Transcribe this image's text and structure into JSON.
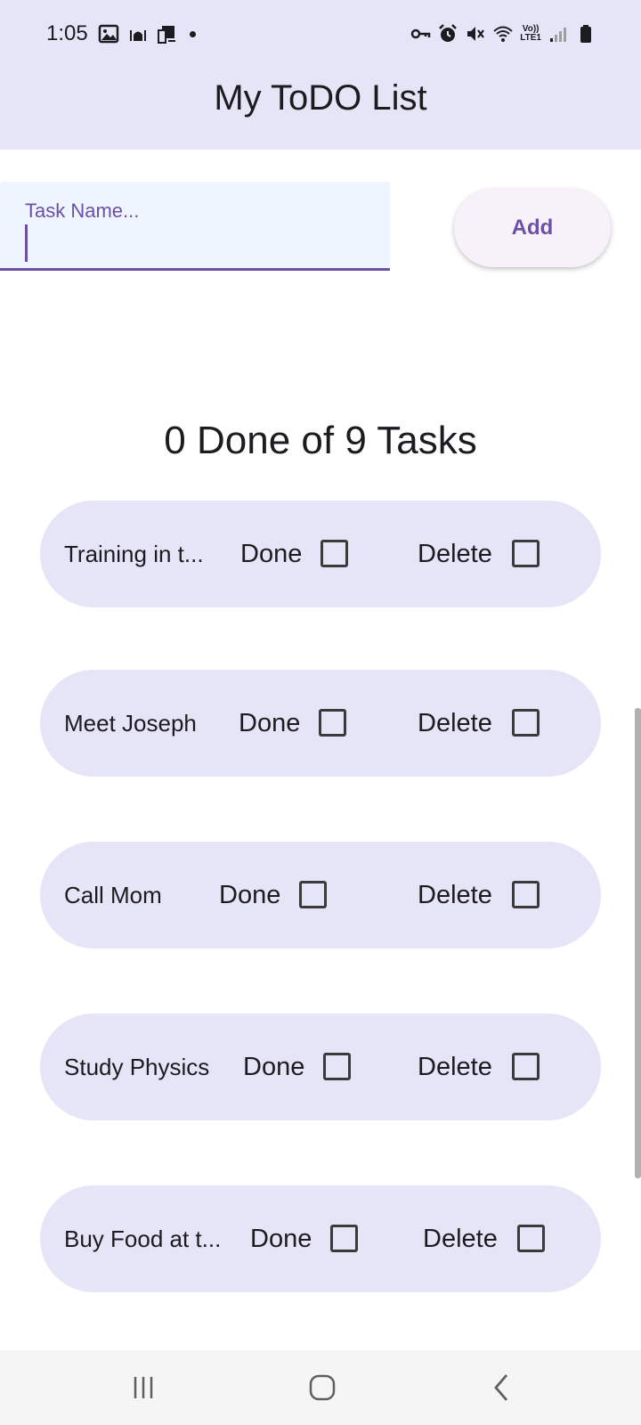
{
  "status_bar": {
    "time": "1:05",
    "left_icons": [
      "gallery-icon",
      "mosque-icon",
      "screen-mirror-icon",
      "notification-dot-icon"
    ],
    "right_icons": [
      "vpn-key-icon",
      "alarm-icon",
      "mute-icon",
      "wifi-icon",
      "volte-lte-icon",
      "signal-icon",
      "battery-icon"
    ],
    "volte_text": "Vo))",
    "lte_text": "LTE1"
  },
  "app_bar": {
    "title": "My ToDO List"
  },
  "input": {
    "label": "Task Name...",
    "value": ""
  },
  "add_button": {
    "label": "Add"
  },
  "summary": "0 Done of 9 Tasks",
  "tasks": [
    {
      "name": "Training in t...",
      "done_label": "Done",
      "delete_label": "Delete",
      "done": false,
      "delete": false
    },
    {
      "name": "Meet Joseph",
      "done_label": "Done",
      "delete_label": "Delete",
      "done": false,
      "delete": false
    },
    {
      "name": "Call Mom",
      "done_label": "Done",
      "delete_label": "Delete",
      "done": false,
      "delete": false
    },
    {
      "name": "Study Physics",
      "done_label": "Done",
      "delete_label": "Delete",
      "done": false,
      "delete": false
    },
    {
      "name": "Buy Food at t...",
      "done_label": "Done",
      "delete_label": "Delete",
      "done": false,
      "delete": false
    }
  ],
  "nav_bar": {
    "buttons": [
      "recent-apps-icon",
      "home-icon",
      "back-icon"
    ]
  },
  "colors": {
    "header_bg": "#e6e5f8",
    "card_bg": "#e6e5f8",
    "accent": "#6b50a6",
    "input_bg": "#eef5ff"
  }
}
